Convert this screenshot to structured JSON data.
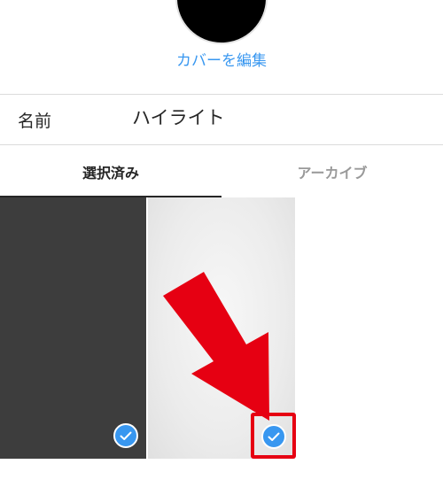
{
  "header": {
    "edit_cover_label": "カバーを編集"
  },
  "name_row": {
    "label": "名前",
    "value": "ハイライト"
  },
  "tabs": [
    {
      "label": "選択済み",
      "selected": true
    },
    {
      "label": "アーカイブ",
      "selected": false
    }
  ],
  "stories": [
    {
      "style": "dark",
      "selected": true
    },
    {
      "style": "light",
      "selected": true
    }
  ],
  "colors": {
    "accent": "#3897f0",
    "annotation": "#e60012",
    "dark_tile": "#3d3d3d",
    "cover": "#000000"
  },
  "icons": {
    "check": "check-icon",
    "annotation_arrow": "arrow-down-right-icon"
  }
}
